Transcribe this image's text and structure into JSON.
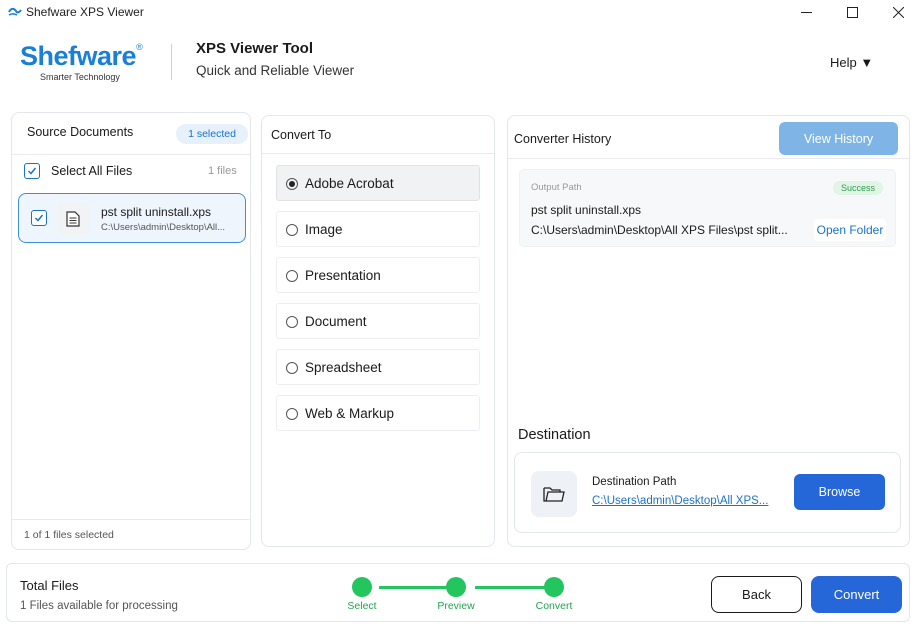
{
  "window": {
    "title": "Shefware XPS Viewer",
    "app_icon": "app-logo-icon",
    "minimize_icon": "minimize-icon",
    "maximize_icon": "maximize-icon",
    "close_icon": "close-icon"
  },
  "header": {
    "logo_text": "Shefware",
    "logo_reg": "®",
    "logo_tagline": "Smarter Technology",
    "title": "XPS Viewer Tool",
    "subtitle": "Quick and Reliable Viewer",
    "help_label": "Help ▼"
  },
  "source": {
    "heading": "Source Documents",
    "selected_badge": "1 selected",
    "select_all_label": "Select All Files",
    "files_count": "1 files",
    "files": [
      {
        "name": "pst split uninstall.xps",
        "path": "C:\\Users\\admin\\Desktop\\All...",
        "checked": true,
        "icon": "document-icon"
      }
    ],
    "footer": "1  of  1  files selected"
  },
  "convert": {
    "heading": "Convert To",
    "options": [
      {
        "label": "Adobe Acrobat",
        "selected": true
      },
      {
        "label": "Image",
        "selected": false
      },
      {
        "label": "Presentation",
        "selected": false
      },
      {
        "label": "Document",
        "selected": false
      },
      {
        "label": "Spreadsheet",
        "selected": false
      },
      {
        "label": "Web & Markup",
        "selected": false
      }
    ]
  },
  "history": {
    "heading": "Converter History",
    "view_button": "View History",
    "entry": {
      "output_label": "Output Path",
      "status": "Success",
      "file_name": "pst split uninstall.xps",
      "path": "C:\\Users\\admin\\Desktop\\All XPS Files\\pst split...",
      "open_folder": "Open Folder"
    }
  },
  "destination": {
    "title": "Destination",
    "label": "Destination Path",
    "path": "C:\\Users\\admin\\Desktop\\All XPS...",
    "browse": "Browse",
    "icon": "folder-icon"
  },
  "footer": {
    "total_title": "Total Files",
    "total_sub": "1 Files available for processing",
    "steps": [
      "Select",
      "Preview",
      "Convert"
    ],
    "back": "Back",
    "convert": "Convert"
  },
  "colors": {
    "accent": "#2566d9",
    "logo": "#1a7fd6",
    "step_green": "#22c55e",
    "view_history_bg": "#7fb5e6"
  }
}
